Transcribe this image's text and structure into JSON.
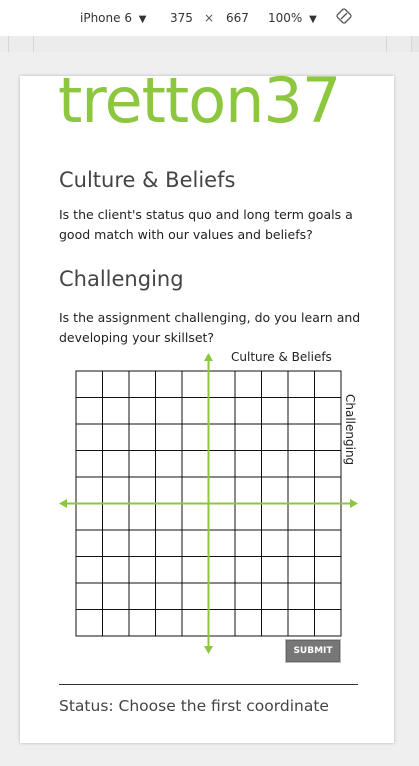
{
  "devtools": {
    "device": "iPhone 6",
    "width": "375",
    "times": "×",
    "height": "667",
    "zoom": "100%",
    "dropdown_glyph": "▼",
    "rotate_icon": "rotate-icon"
  },
  "logo": "tretton37",
  "sections": [
    {
      "heading": "Culture & Beliefs",
      "text": "Is the client's status quo and long term goals a good match with our values and beliefs?"
    },
    {
      "heading": "Challenging",
      "text": "Is the assignment challenging, do you learn and developing your skillset?"
    }
  ],
  "grid": {
    "y_axis_label": "Culture & Beliefs",
    "x_axis_label": "Challenging",
    "rows": 10,
    "cols": 10,
    "axis_color": "#8dc63f"
  },
  "submit_label": "SUBMIT",
  "status": "Status: Choose the first coordinate"
}
